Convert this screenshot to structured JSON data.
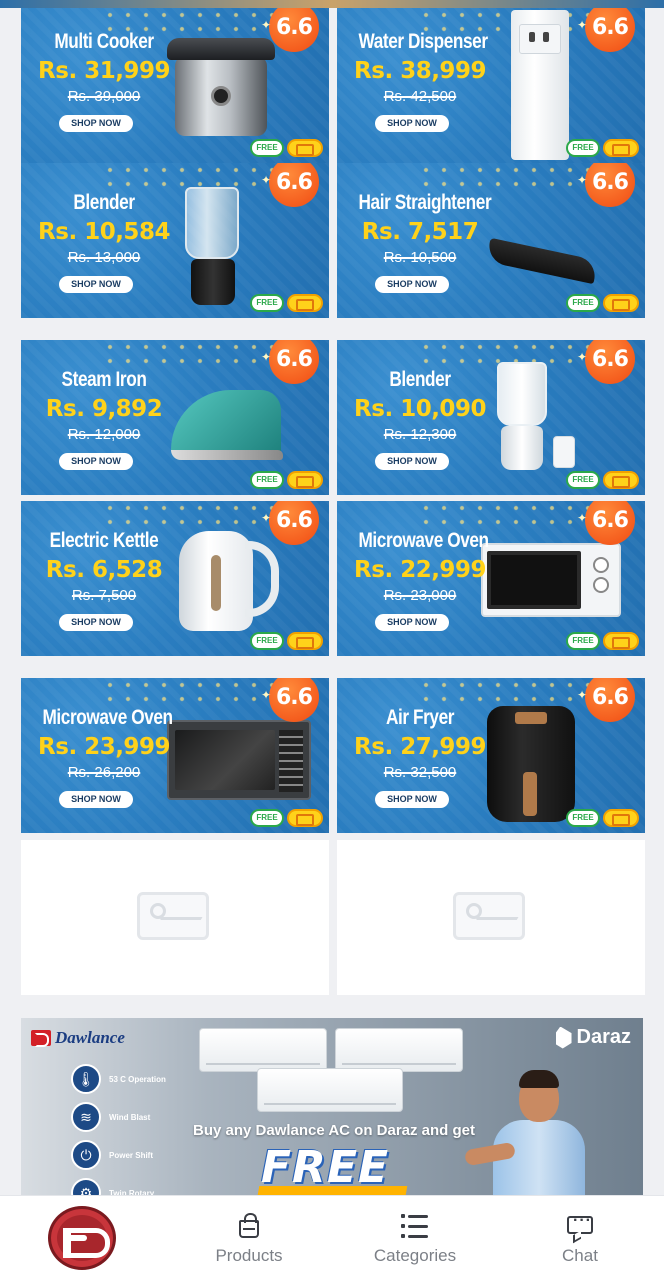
{
  "deal_badge": "6.6",
  "shop_label": "SHOP NOW",
  "free_tag": "FREE",
  "products": [
    {
      "name": "Multi Cooker",
      "price": "Rs. 31,999",
      "old_price": "Rs. 39,000"
    },
    {
      "name": "Water Dispenser",
      "price": "Rs. 38,999",
      "old_price": "Rs. 42,500"
    },
    {
      "name": "Blender",
      "price": "Rs. 10,584",
      "old_price": "Rs. 13,000"
    },
    {
      "name": "Hair Straightener",
      "price": "Rs. 7,517",
      "old_price": "Rs. 10,500"
    },
    {
      "name": "Steam Iron",
      "price": "Rs. 9,892",
      "old_price": "Rs. 12,000"
    },
    {
      "name": "Blender",
      "price": "Rs. 10,090",
      "old_price": "Rs. 12,300"
    },
    {
      "name": "Electric Kettle",
      "price": "Rs. 6,528",
      "old_price": "Rs. 7,500"
    },
    {
      "name": "Microwave Oven",
      "price": "Rs. 22,999",
      "old_price": "Rs. 23,000"
    },
    {
      "name": "Microwave Oven",
      "price": "Rs. 23,999",
      "old_price": "Rs. 26,200"
    },
    {
      "name": "Air Fryer",
      "price": "Rs. 27,999",
      "old_price": "Rs. 32,500"
    }
  ],
  "ac_banner": {
    "brand": "Dawlance",
    "partner": "Daraz",
    "features": [
      "53 C Operation",
      "Wind Blast",
      "Power Shift",
      "Twin Rotary"
    ],
    "caption": "Buy any Dawlance AC on Daraz and get",
    "headline": "FREE"
  },
  "bottom_nav": {
    "products": "Products",
    "categories": "Categories",
    "chat": "Chat"
  }
}
